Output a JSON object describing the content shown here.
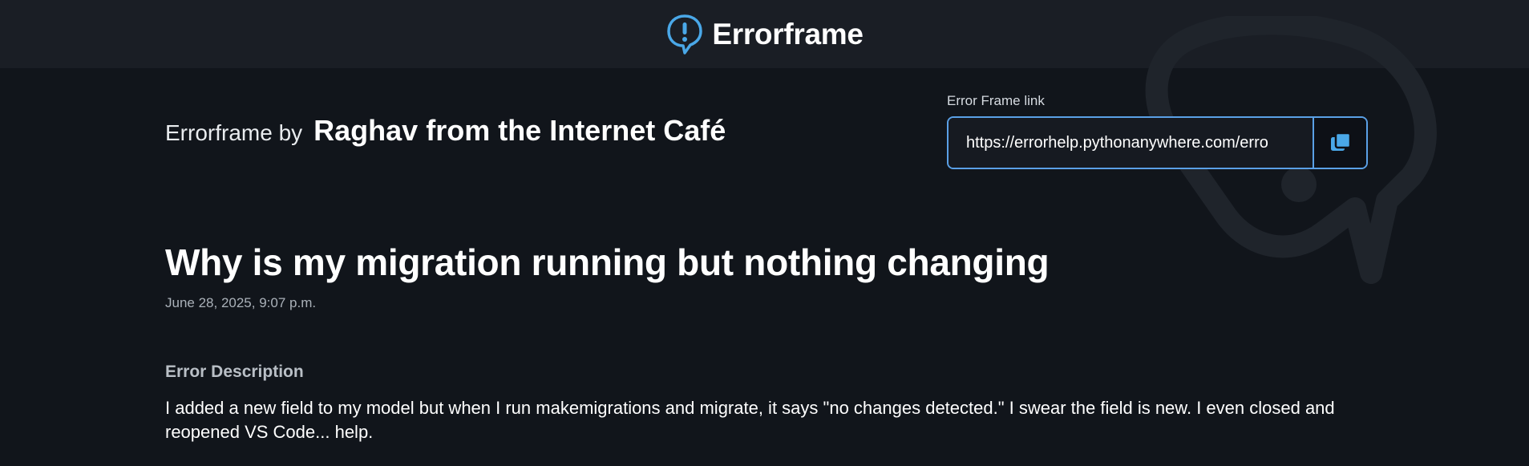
{
  "header": {
    "app_name": "Errorframe",
    "icon": "exclamation-speech-bubble-icon",
    "background": "#1a1e25",
    "accent": "#4aa8e8"
  },
  "author": {
    "prefix": "Errorframe by",
    "name": "Raghav from the Internet Café"
  },
  "share": {
    "label": "Error Frame link",
    "url": "https://errorhelp.pythonanywhere.com/erro",
    "copy_icon": "copy-icon",
    "border_color": "#5aa0e6"
  },
  "question": {
    "title": "Why is my migration running but nothing changing",
    "date": "June 28, 2025, 9:07 p.m."
  },
  "description": {
    "heading": "Error Description",
    "body": "I added a new field to my model but when I run makemigrations and migrate, it says \"no changes detected.\" I swear the field is new. I even closed and reopened VS Code... help."
  },
  "theme": {
    "page_background": "#11151b",
    "watermark_color": "#1f242b"
  }
}
